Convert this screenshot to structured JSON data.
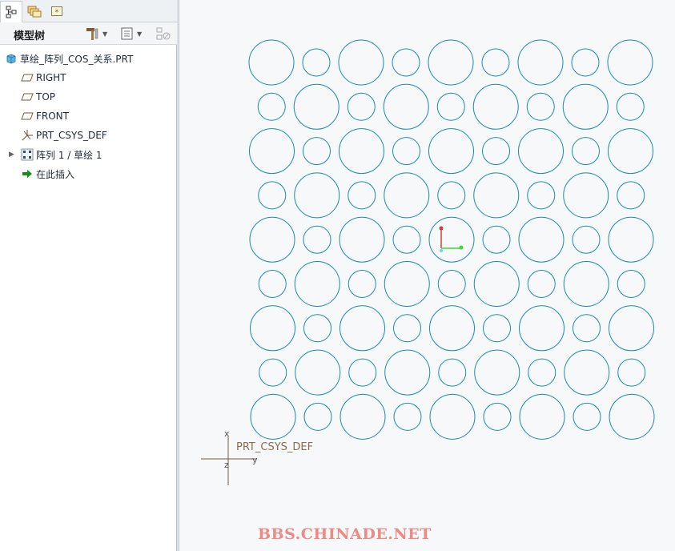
{
  "tabs": [
    {
      "name": "model-tree-tab",
      "icon": "tree-structure-icon"
    },
    {
      "name": "folder-browser-tab",
      "icon": "folders-icon"
    },
    {
      "name": "favorites-tab",
      "icon": "star-box-icon"
    }
  ],
  "tree_header": {
    "title": "模型树"
  },
  "tree": {
    "root": "草绘_阵列_COS_关系.PRT",
    "items": [
      "RIGHT",
      "TOP",
      "FRONT",
      "PRT_CSYS_DEF",
      "阵列 1 / 草绘 1",
      "在此插入"
    ]
  },
  "canvas": {
    "csys_label": "PRT_CSYS_DEF",
    "axis_x": "x",
    "axis_y": "y",
    "axis_z": "z",
    "watermark": "BBS.CHINADE.NET"
  },
  "colors": {
    "circle": "#1b8ab0",
    "csys": "#7a5a3a",
    "watermark": "#ee8a86"
  }
}
